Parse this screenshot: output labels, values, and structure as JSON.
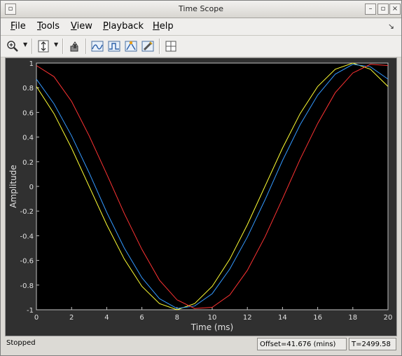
{
  "window": {
    "title": "Time Scope"
  },
  "menu": [
    "File",
    "Tools",
    "View",
    "Playback",
    "Help"
  ],
  "toolbar": {
    "tools": [
      "zoom-in",
      "autoscale-y",
      "bring-to-front",
      "signal-statistics",
      "bilevel-measurements",
      "peak-finder",
      "cursor-measurements",
      "layout"
    ]
  },
  "chart_data": {
    "type": "line",
    "xlabel": "Time (ms)",
    "ylabel": "Amplitude",
    "xlim": [
      0,
      20
    ],
    "ylim": [
      -1,
      1
    ],
    "xticks": [
      0,
      2,
      4,
      6,
      8,
      10,
      12,
      14,
      16,
      18,
      20
    ],
    "yticks": [
      1,
      0.8,
      0.6,
      0.4,
      0.2,
      0,
      -0.2,
      -0.4,
      -0.6,
      -0.8,
      -1
    ],
    "grid": false,
    "background": "#000000",
    "series": [
      {
        "color": "#ffff33",
        "x": [
          0,
          1,
          2,
          3,
          4,
          5,
          6,
          7,
          8,
          9,
          10,
          11,
          12,
          13,
          14,
          15,
          16,
          17,
          18,
          19,
          20
        ],
        "y": [
          0.81,
          0.59,
          0.31,
          0.0,
          -0.31,
          -0.59,
          -0.81,
          -0.95,
          -1.0,
          -0.95,
          -0.81,
          -0.59,
          -0.31,
          0.0,
          0.31,
          0.59,
          0.81,
          0.95,
          1.0,
          0.95,
          0.81
        ]
      },
      {
        "color": "#3399ff",
        "x": [
          0,
          1,
          2,
          3,
          4,
          5,
          6,
          7,
          8,
          9,
          10,
          11,
          12,
          13,
          14,
          15,
          16,
          17,
          18,
          19,
          20
        ],
        "y": [
          0.87,
          0.67,
          0.41,
          0.11,
          -0.21,
          -0.5,
          -0.74,
          -0.91,
          -0.99,
          -0.97,
          -0.87,
          -0.67,
          -0.41,
          -0.11,
          0.21,
          0.5,
          0.74,
          0.91,
          0.99,
          0.97,
          0.87
        ]
      },
      {
        "color": "#ff3333",
        "x": [
          0,
          1,
          2,
          3,
          4,
          5,
          6,
          7,
          8,
          9,
          10,
          11,
          12,
          13,
          14,
          15,
          16,
          17,
          18,
          19,
          20
        ],
        "y": [
          0.98,
          0.89,
          0.69,
          0.41,
          0.1,
          -0.22,
          -0.51,
          -0.76,
          -0.92,
          -0.99,
          -0.98,
          -0.88,
          -0.68,
          -0.41,
          -0.1,
          0.22,
          0.51,
          0.76,
          0.92,
          0.99,
          0.98
        ]
      }
    ]
  },
  "status": {
    "state": "Stopped",
    "offset": "Offset=41.676 (mins)",
    "time": "T=2499.58"
  }
}
